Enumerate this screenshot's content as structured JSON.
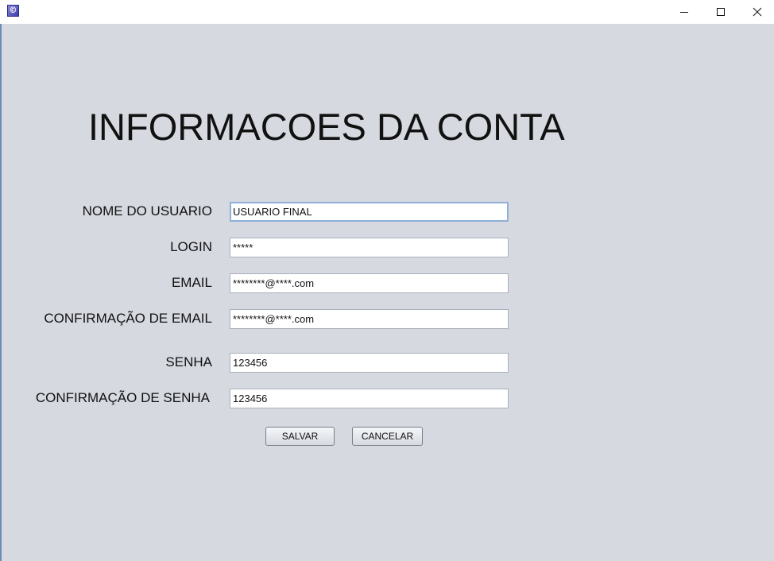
{
  "window": {
    "app_icon": "java-app-icon",
    "controls": [
      "minimize-icon",
      "maximize-icon",
      "close-icon"
    ]
  },
  "page": {
    "title": "INFORMACOES DA CONTA"
  },
  "form": {
    "fields": [
      {
        "label": "NOME DO USUARIO",
        "value": "USUARIO FINAL",
        "focused": true
      },
      {
        "label": "LOGIN",
        "value": "*****"
      },
      {
        "label": "EMAIL",
        "value": "********@****.com"
      },
      {
        "label": "CONFIRMAÇÃO DE EMAIL",
        "value": "********@****.com"
      },
      {
        "label": "SENHA",
        "value": "123456"
      },
      {
        "label": "CONFIRMAÇÃO DE SENHA",
        "value": "123456"
      }
    ],
    "buttons": {
      "save_label": "SALVAR",
      "cancel_label": "CANCELAR"
    }
  },
  "colors": {
    "background": "#d6d9e0",
    "focus_border": "#8fb0d8"
  }
}
